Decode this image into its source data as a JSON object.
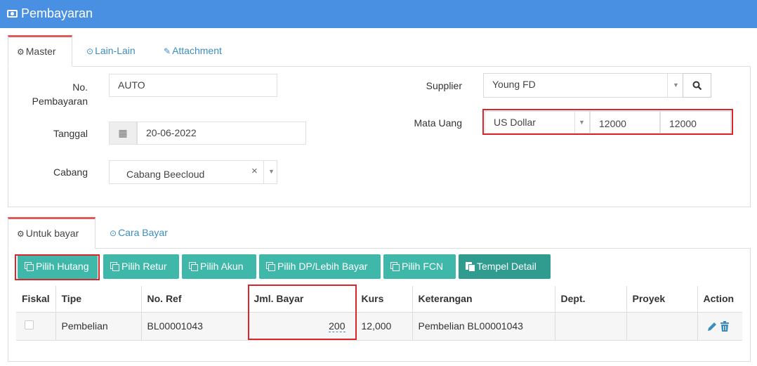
{
  "header": {
    "title": "Pembayaran",
    "icon": "money-icon"
  },
  "top_tabs": [
    {
      "label": "Master",
      "icon": "gears-icon"
    },
    {
      "label": "Lain-Lain",
      "icon": "check-circle-icon"
    },
    {
      "label": "Attachment",
      "icon": "paperclip-icon"
    }
  ],
  "form": {
    "no_pembayaran": {
      "label_line1": "No.",
      "label_line2": "Pembayaran",
      "value": "AUTO"
    },
    "tanggal": {
      "label": "Tanggal",
      "value": "20-06-2022"
    },
    "cabang": {
      "label": "Cabang",
      "value": "Cabang Beecloud",
      "clear": "×",
      "caret": "▼"
    },
    "supplier": {
      "label": "Supplier",
      "value": "Young FD",
      "caret": "▼"
    },
    "mata_uang": {
      "label": "Mata Uang",
      "value": "US Dollar",
      "caret": "▼",
      "rate1": "12000",
      "rate2": "12000"
    }
  },
  "bottom_tabs": [
    {
      "label": "Untuk bayar",
      "icon": "gears-icon"
    },
    {
      "label": "Cara Bayar",
      "icon": "check-circle-icon"
    }
  ],
  "buttons": [
    {
      "label": "Pilih Hutang"
    },
    {
      "label": "Pilih Retur"
    },
    {
      "label": "Pilih Akun"
    },
    {
      "label": "Pilih DP/Lebih Bayar"
    },
    {
      "label": "Pilih FCN"
    },
    {
      "label": "Tempel Detail"
    }
  ],
  "table": {
    "headers": [
      "Fiskal",
      "Tipe",
      "No. Ref",
      "Jml. Bayar",
      "Kurs",
      "Keterangan",
      "Dept.",
      "Proyek",
      "Action"
    ],
    "rows": [
      {
        "tipe": "Pembelian",
        "no_ref": "BL00001043",
        "jml_bayar": "200",
        "kurs": "12,000",
        "keterangan": "Pembelian BL00001043",
        "dept": "",
        "proyek": ""
      }
    ]
  },
  "colors": {
    "header": "#4a90e2",
    "button": "#3fb8a9",
    "highlight": "#d9262c",
    "link": "#3c8dbc"
  }
}
